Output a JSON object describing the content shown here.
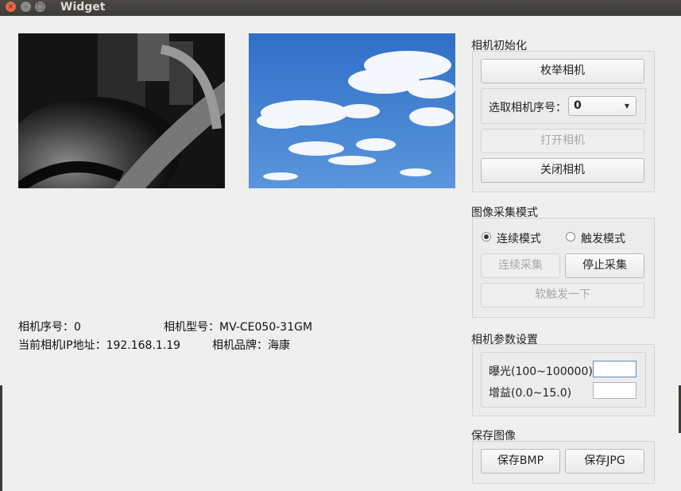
{
  "window": {
    "title": "Widget",
    "close_glyph": "×",
    "min_glyph": "–",
    "max_glyph": "□"
  },
  "info": {
    "camera_index": "相机序号：0",
    "camera_model": "相机型号：MV-CE050-31GM",
    "camera_ip": "当前相机IP地址：192.168.1.19",
    "camera_brand": "相机品牌：海康"
  },
  "init_group": {
    "title": "相机初始化",
    "enum_button": "枚举相机",
    "select_label": "选取相机序号：",
    "select_value": "0",
    "open_button": "打开相机",
    "close_button": "关闭相机"
  },
  "mode_group": {
    "title": "图像采集模式",
    "continuous_label": "连续模式",
    "trigger_label": "触发模式",
    "continuous_checked": true,
    "start_button": "连续采集",
    "stop_button": "停止采集",
    "soft_trigger_button": "软触发一下"
  },
  "param_group": {
    "title": "相机参数设置",
    "exposure_label": "曝光(100~100000)",
    "exposure_value": "",
    "gain_label": "增益(0.0~15.0)",
    "gain_value": ""
  },
  "save_group": {
    "title": "保存图像",
    "bmp_button": "保存BMP",
    "jpg_button": "保存JPG"
  },
  "icons": {
    "dropdown": "chevron-down-icon"
  },
  "colors": {
    "titlebar": "#3c3b37",
    "close_button": "#e8683e",
    "background": "#efefef",
    "focus_border": "#5b8ac6"
  }
}
